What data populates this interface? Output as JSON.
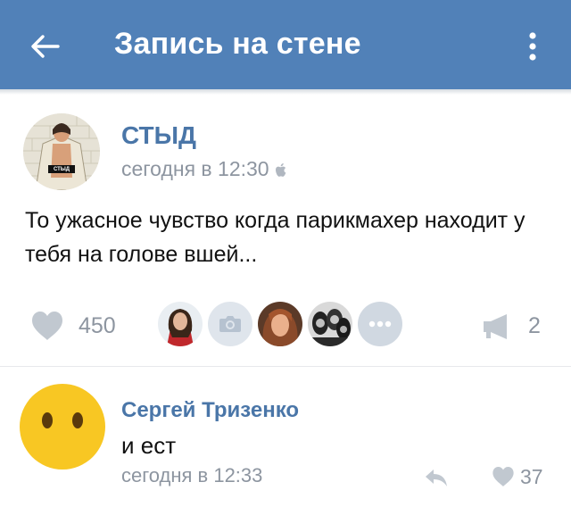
{
  "header": {
    "title": "Запись на стене",
    "back_icon": "arrow-left-icon",
    "menu_icon": "more-vertical-icon",
    "background": "#5181b8"
  },
  "post": {
    "author": "СТЫД",
    "avatar_caption": "СТЫД",
    "time": "сегодня в 12:30",
    "platform_icon": "apple-icon",
    "text": "То ужасное чувство когда парикмахер находит у тебя на голове вшей...",
    "likes": "450",
    "shares": "2",
    "likers": [
      "avatar-1",
      "camera-placeholder",
      "avatar-3",
      "avatar-4",
      "more"
    ]
  },
  "comment": {
    "author": "Сергей Тризенко",
    "text": "и ест",
    "time": "сегодня в 12:33",
    "likes": "37"
  },
  "colors": {
    "link": "#4a76a8",
    "meta": "#8d95a0",
    "icon": "#bcc3cc"
  }
}
